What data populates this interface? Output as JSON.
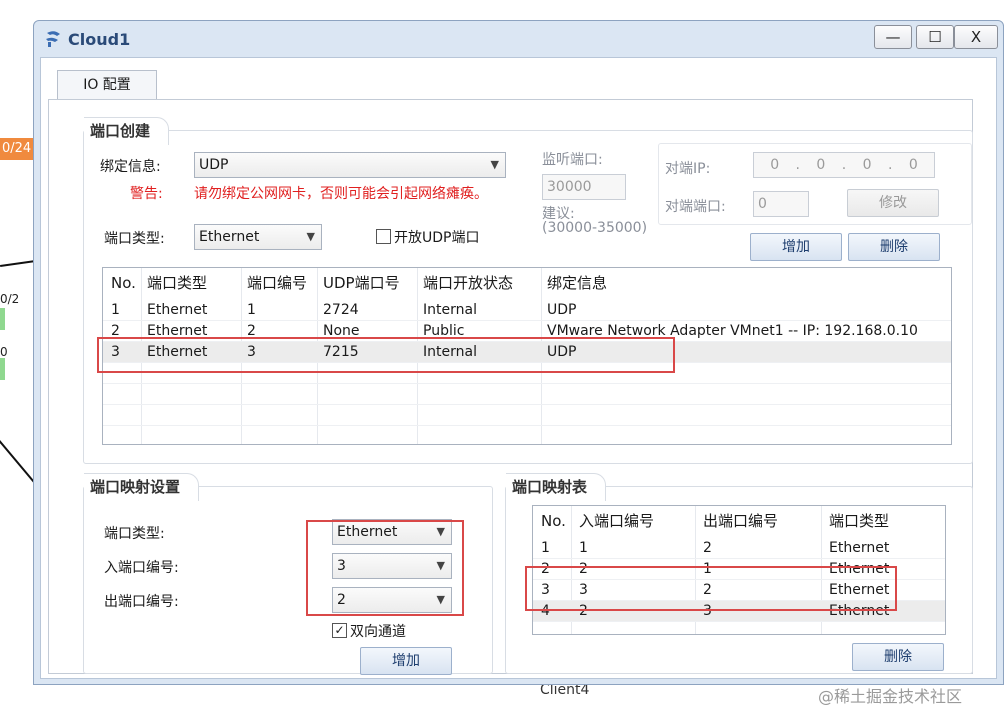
{
  "background": {
    "port_tag": "0/24",
    "label_a": "0/2",
    "label_b": "0",
    "client_label": "Client4",
    "watermark": "@稀土掘金技术社区",
    "accent_color": "#f08a3e"
  },
  "window": {
    "title": "Cloud1",
    "controls": {
      "minimize": "—",
      "maximize": "☐",
      "close": "X"
    }
  },
  "tab": {
    "label": "IO 配置"
  },
  "port_creation": {
    "title": "端口创建",
    "bind_label": "绑定信息:",
    "bind_value": "UDP",
    "warn_label": "警告:",
    "warn_text": "请勿绑定公网网卡，否则可能会引起网络瘫痪。",
    "port_type_label": "端口类型:",
    "port_type_value": "Ethernet",
    "open_udp_label": "开放UDP端口",
    "listen_label": "监听端口:",
    "listen_value": "30000",
    "suggest_label": "建议:",
    "suggest_range": "(30000-35000)",
    "peer_ip_label": "对端IP:",
    "peer_ip_value": [
      "0",
      "0",
      "0",
      "0"
    ],
    "peer_port_label": "对端端口:",
    "peer_port_value": "0",
    "modify_button": "修改",
    "add_button": "增加",
    "delete_button": "删除",
    "table": {
      "headers": [
        "No.",
        "端口类型",
        "端口编号",
        "UDP端口号",
        "端口开放状态",
        "绑定信息"
      ],
      "rows": [
        [
          "1",
          "Ethernet",
          "1",
          "2724",
          "Internal",
          "UDP"
        ],
        [
          "2",
          "Ethernet",
          "2",
          "None",
          "Public",
          "VMware Network Adapter VMnet1 -- IP: 192.168.0.10"
        ],
        [
          "3",
          "Ethernet",
          "3",
          "7215",
          "Internal",
          "UDP"
        ]
      ]
    }
  },
  "mapping_settings": {
    "title": "端口映射设置",
    "port_type_label": "端口类型:",
    "port_type_value": "Ethernet",
    "in_port_label": "入端口编号:",
    "in_port_value": "3",
    "out_port_label": "出端口编号:",
    "out_port_value": "2",
    "bidirectional_label": "双向通道",
    "bidirectional_checked": true,
    "add_button": "增加"
  },
  "mapping_table": {
    "title": "端口映射表",
    "headers": [
      "No.",
      "入端口编号",
      "出端口编号",
      "端口类型"
    ],
    "rows": [
      [
        "1",
        "1",
        "2",
        "Ethernet"
      ],
      [
        "2",
        "2",
        "1",
        "Ethernet"
      ],
      [
        "3",
        "3",
        "2",
        "Ethernet"
      ],
      [
        "4",
        "2",
        "3",
        "Ethernet"
      ]
    ],
    "delete_button": "删除"
  }
}
